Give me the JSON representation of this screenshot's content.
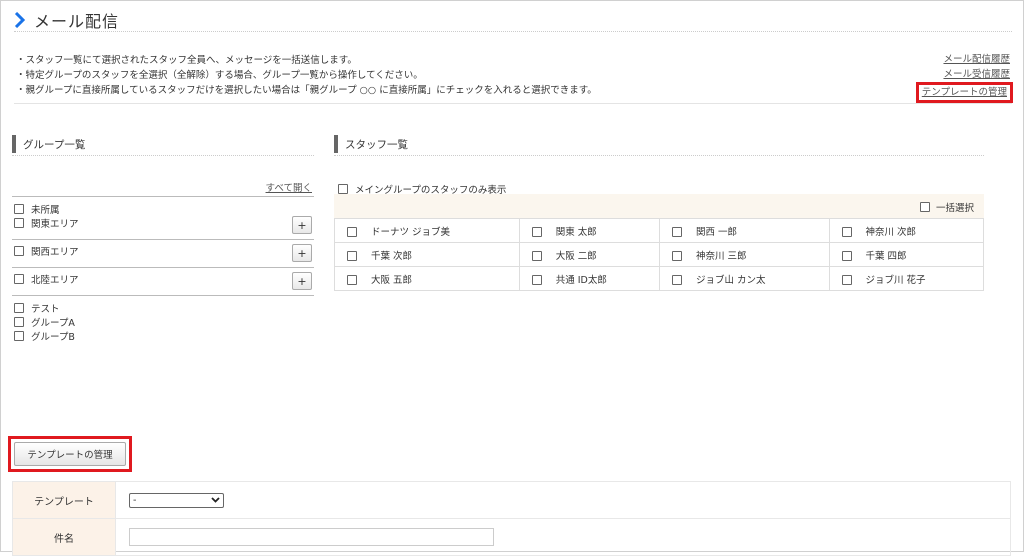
{
  "page": {
    "title": "メール配信"
  },
  "notes": [
    "・スタッフ一覧にて選択されたスタッフ全員へ、メッセージを一括送信します。",
    "・特定グループのスタッフを全選択（全解除）する場合、グループ一覧から操作してください。",
    "・親グループに直接所属しているスタッフだけを選択したい場合は「親グループ ○○ に直接所属」にチェックを入れると選択できます。"
  ],
  "links": {
    "history_sent": "メール配信履歴",
    "history_received": "メール受信履歴",
    "template_manage": "テンプレートの管理"
  },
  "groups": {
    "heading": "グループ一覧",
    "open_all": "すべて開く",
    "unassigned": "未所属",
    "kanto": "関東エリア",
    "kansai": "関西エリア",
    "hokuriku": "北陸エリア",
    "test": "テスト",
    "group_a": "グループA",
    "group_b": "グループB",
    "plus": "+"
  },
  "staff": {
    "heading": "スタッフ一覧",
    "main_only": "メイングループのスタッフのみ表示",
    "bulk_select": "一括選択",
    "rows": [
      [
        "ドーナツ ジョブ美",
        "関東 太郎",
        "関西 一郎",
        "神奈川 次郎"
      ],
      [
        "千葉 次郎",
        "大阪 二郎",
        "神奈川 三郎",
        "千葉 四郎"
      ],
      [
        "大阪 五郎",
        "共通 ID太郎",
        "ジョブ山 カン太",
        "ジョブ川 花子"
      ]
    ]
  },
  "template_button": "テンプレートの管理",
  "form": {
    "template_label": "テンプレート",
    "template_value": "-",
    "subject_label": "件名",
    "subject_value": ""
  },
  "colors": {
    "accent": "#1a73e8",
    "highlight": "#e0191f",
    "header_bg": "#fcf2e8"
  }
}
